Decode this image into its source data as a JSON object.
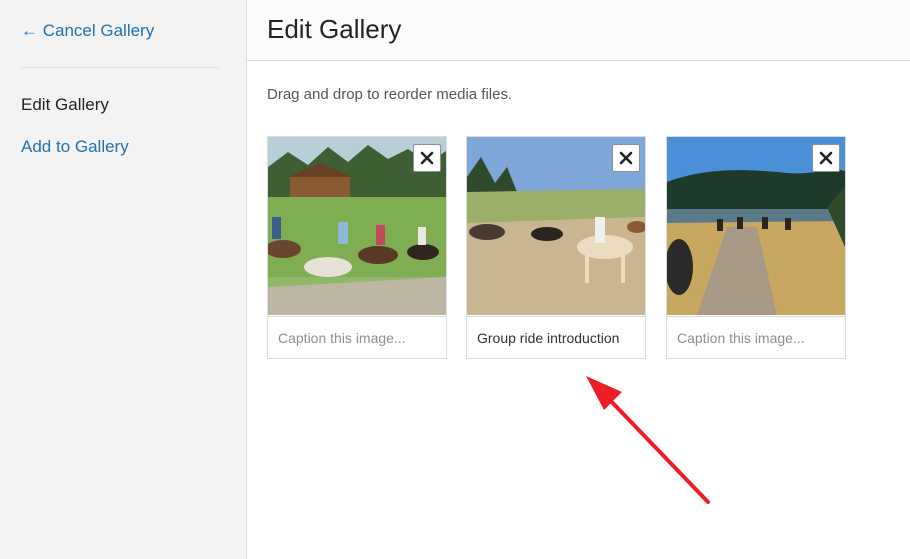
{
  "sidebar": {
    "cancel_label": "← Cancel Gallery",
    "items": [
      {
        "label": "Edit Gallery"
      },
      {
        "label": "Add to Gallery"
      }
    ]
  },
  "header": {
    "title": "Edit Gallery"
  },
  "main": {
    "instructions": "Drag and drop to reorder media files.",
    "images": [
      {
        "caption": "",
        "placeholder": "Caption this image..."
      },
      {
        "caption": "Group ride introduction",
        "placeholder": "Caption this image..."
      },
      {
        "caption": "",
        "placeholder": "Caption this image..."
      }
    ]
  },
  "colors": {
    "link": "#2271b1",
    "annotation_arrow": "#ee1c25"
  },
  "icons": {
    "remove": "close-icon",
    "annotation": "arrow-icon"
  }
}
